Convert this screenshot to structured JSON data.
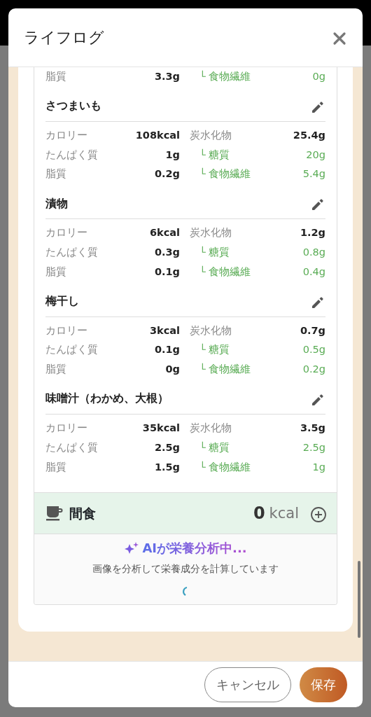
{
  "window": {
    "title": "ライフログ"
  },
  "cut_row": {
    "label": "脂質",
    "value": "3.3g",
    "label_2": "└ 食物繊維",
    "value_2": "0g"
  },
  "foods": [
    {
      "name": "さつまいも",
      "rows": [
        {
          "label": "カロリー",
          "value": "108kcal",
          "label_2": "炭水化物",
          "value_2": "25.4g",
          "kind": "main"
        },
        {
          "label": "たんぱく質",
          "value": "1g",
          "label_2": "└ 糖質",
          "value_2": "20g",
          "kind": "sub"
        },
        {
          "label": "脂質",
          "value": "0.2g",
          "label_2": "└ 食物繊維",
          "value_2": "5.4g",
          "kind": "sub"
        }
      ]
    },
    {
      "name": "漬物",
      "rows": [
        {
          "label": "カロリー",
          "value": "6kcal",
          "label_2": "炭水化物",
          "value_2": "1.2g",
          "kind": "main"
        },
        {
          "label": "たんぱく質",
          "value": "0.3g",
          "label_2": "└ 糖質",
          "value_2": "0.8g",
          "kind": "sub"
        },
        {
          "label": "脂質",
          "value": "0.1g",
          "label_2": "└ 食物繊維",
          "value_2": "0.4g",
          "kind": "sub"
        }
      ]
    },
    {
      "name": "梅干し",
      "rows": [
        {
          "label": "カロリー",
          "value": "3kcal",
          "label_2": "炭水化物",
          "value_2": "0.7g",
          "kind": "main"
        },
        {
          "label": "たんぱく質",
          "value": "0.1g",
          "label_2": "└ 糖質",
          "value_2": "0.5g",
          "kind": "sub"
        },
        {
          "label": "脂質",
          "value": "0g",
          "label_2": "└ 食物繊維",
          "value_2": "0.2g",
          "kind": "sub"
        }
      ]
    },
    {
      "name": "味噌汁（わかめ、大根）",
      "rows": [
        {
          "label": "カロリー",
          "value": "35kcal",
          "label_2": "炭水化物",
          "value_2": "3.5g",
          "kind": "main"
        },
        {
          "label": "たんぱく質",
          "value": "2.5g",
          "label_2": "└ 糖質",
          "value_2": "2.5g",
          "kind": "sub"
        },
        {
          "label": "脂質",
          "value": "1.5g",
          "label_2": "└ 食物繊維",
          "value_2": "1g",
          "kind": "sub"
        }
      ]
    }
  ],
  "snack": {
    "title": "間食",
    "calories": "0",
    "unit": "kcal"
  },
  "analysis": {
    "title": "AIが栄養分析中...",
    "message": "画像を分析して栄養成分を計算しています"
  },
  "buttons": [
    {
      "label": "キャンセル",
      "kind": "secondary"
    },
    {
      "label": "保存",
      "kind": "primary"
    }
  ]
}
